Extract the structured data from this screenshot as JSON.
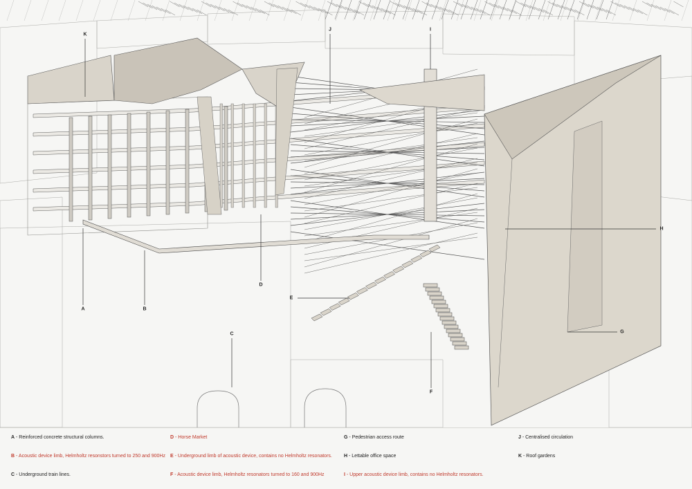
{
  "colors": {
    "background": "#f6f6f4",
    "line": "#5a5a58",
    "surface": "#d9d4ca",
    "surface_dark": "#c9c3b8",
    "legend_text": "#222222",
    "legend_highlight": "#c0392b"
  },
  "callouts": [
    "A",
    "B",
    "C",
    "D",
    "E",
    "F",
    "G",
    "H",
    "I",
    "J",
    "K"
  ],
  "legend": [
    {
      "key": "A",
      "text": " - Reinforced concrete structural columns.",
      "highlight": false
    },
    {
      "key": "B",
      "text": " - Acoustic device limb, Helmholtz resonstors turned to 250 and 900Hz",
      "highlight": true
    },
    {
      "key": "C",
      "text": " - Underground train lines.",
      "highlight": false
    },
    {
      "key": "D",
      "text": " - Horse Market",
      "highlight": true
    },
    {
      "key": "E",
      "text": " - Underground limb of acoustic device, contains no Helmholtz resonators.",
      "highlight": true
    },
    {
      "key": "F",
      "text": " - Acoustic device limb, Helmholtz resonators turned to 160 and 900Hz",
      "highlight": true
    },
    {
      "key": "G",
      "text": " - Pedestrian access route",
      "highlight": false
    },
    {
      "key": "H",
      "text": " - Lettable office space",
      "highlight": false
    },
    {
      "key": "I",
      "text": " - Upper acoustic device limb, contains no Helmholtz resonators.",
      "highlight": true
    },
    {
      "key": "J",
      "text": " - Centralised circulation",
      "highlight": false
    },
    {
      "key": "K",
      "text": " - Roof gardens",
      "highlight": false
    }
  ]
}
